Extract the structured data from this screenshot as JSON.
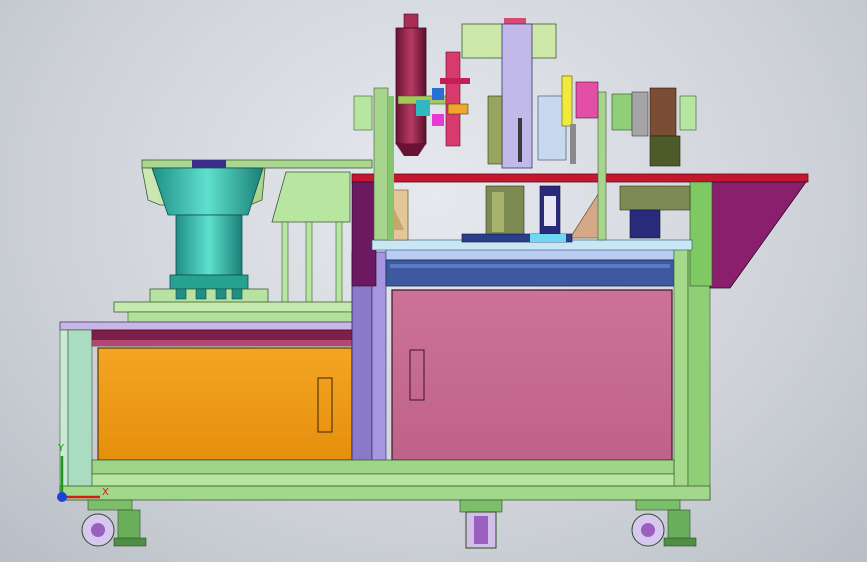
{
  "viewport": {
    "background": "#cfd3d9"
  },
  "triad": {
    "x_label": "X",
    "y_label": "Y",
    "x_color": "#d21b1b",
    "y_color": "#1a9a1a",
    "z_color": "#1f3fd6"
  },
  "colors": {
    "frame_green": "#9fd68a",
    "cabinet_orange": "#ef9a12",
    "cabinet_pink": "#c86c92",
    "table_top_red": "#c4172e",
    "side_panel_purple": "#8a1f6e",
    "bowl_teal": "#2fb7a5",
    "cylinder_maroon": "#8e1f45",
    "column_purple": "#8877c8",
    "leveling_blue": "#2b3f7a"
  }
}
